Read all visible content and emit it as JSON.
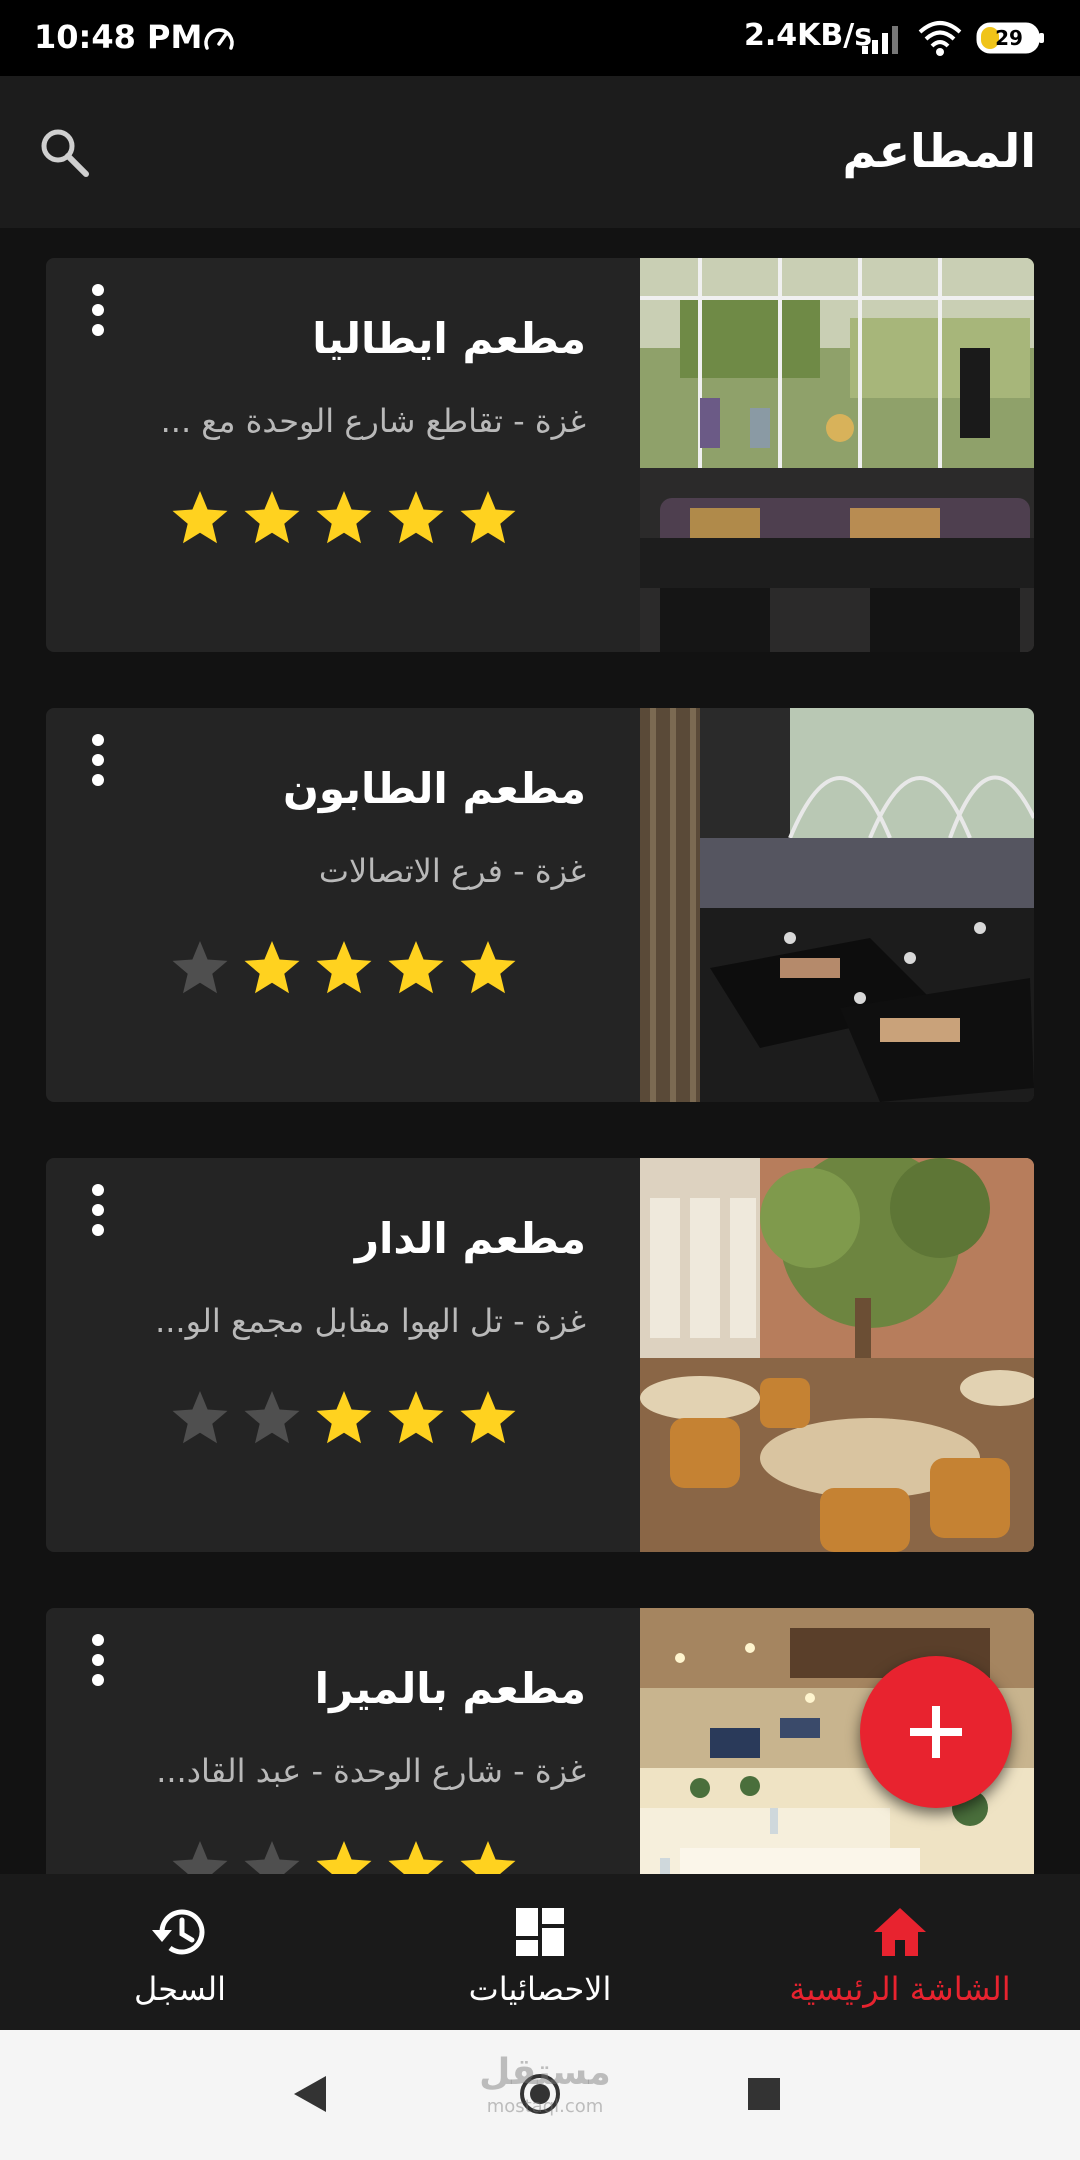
{
  "status_bar": {
    "time": "10:48 PM",
    "network_speed": "2.4KB/s",
    "battery_level": "29"
  },
  "app_bar": {
    "title": "المطاعم",
    "search_icon": "search-icon"
  },
  "restaurants": [
    {
      "name": "مطعم ايطاليا",
      "address": "غزة - تقاطع شارع الوحدة مع ...",
      "rating": 5,
      "max_rating": 5
    },
    {
      "name": "مطعم الطابون",
      "address": "غزة - فرع الاتصالات",
      "rating": 4,
      "max_rating": 5
    },
    {
      "name": "مطعم الدار",
      "address": "غزة - تل الهوا مقابل مجمع الو...",
      "rating": 3,
      "max_rating": 5
    },
    {
      "name": "مطعم بالميرا",
      "address": "غزة - شارع الوحدة - عبد القاد...",
      "rating": 3,
      "max_rating": 5
    }
  ],
  "fab": {
    "icon": "plus-icon"
  },
  "bottom_nav": {
    "items": [
      {
        "label": "الشاشة الرئيسية",
        "icon": "home-icon",
        "active": true
      },
      {
        "label": "الاحصائيات",
        "icon": "dashboard-icon",
        "active": false
      },
      {
        "label": "السجل",
        "icon": "history-icon",
        "active": false
      }
    ]
  },
  "watermark": {
    "text": "مستقل",
    "subtext": "mostaql.com"
  },
  "colors": {
    "accent": "#e8232f",
    "star_filled": "#ffd21f",
    "star_empty": "#4f4f4f",
    "card_background": "#242424",
    "screen_background": "#121212"
  }
}
